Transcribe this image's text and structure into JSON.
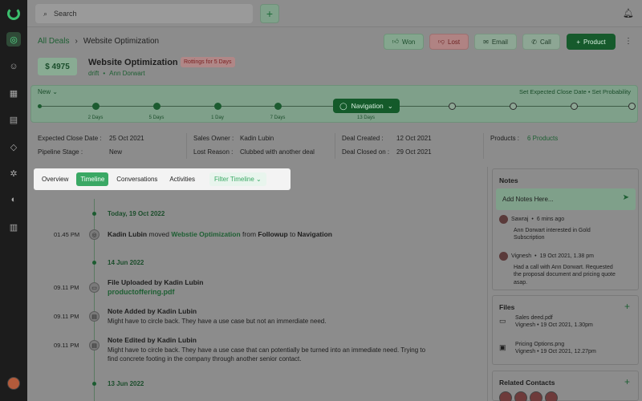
{
  "search": {
    "placeholder": "Search"
  },
  "breadcrumb": {
    "parent": "All Deals",
    "current": "Website Optimization"
  },
  "actions": {
    "won": "Won",
    "lost": "Lost",
    "email": "Email",
    "call": "Call",
    "product": "Product"
  },
  "deal": {
    "amount": "$ 4975",
    "title": "Website Optimization",
    "badge": "Rottings for 5 Days",
    "source": "drift",
    "contact": "Ann Dorwart"
  },
  "pipeline": {
    "stage": "New",
    "set_close": "Set Expected Close Date",
    "set_prob": "Set Probability",
    "current": "Navigation",
    "labels": [
      "2 Days",
      "5 Days",
      "1 Day",
      "7 Days",
      "13 Days"
    ]
  },
  "info": {
    "expected_close_label": "Expected Close Date :",
    "expected_close": "25 Oct 2021",
    "pipeline_stage_label": "Pipeline Stage :",
    "pipeline_stage": "New",
    "sales_owner_label": "Sales Owner :",
    "sales_owner": "Kadin Lubin",
    "lost_reason_label": "Lost Reason :",
    "lost_reason": "Clubbed with another deal",
    "created_label": "Deal Created :",
    "created": "12 Oct 2021",
    "closed_label": "Deal Closed on :",
    "closed": "29 Oct 2021",
    "products_label": "Products :",
    "products": "6 Products"
  },
  "tabs": {
    "overview": "Overview",
    "timeline": "Timeline",
    "conversations": "Conversations",
    "activities": "Activities",
    "filter": "Filter Timeline"
  },
  "timeline": {
    "date1": "Today, 19 Oct 2022",
    "e1_time": "01.45 PM",
    "e1_name": "Kadin Lubin",
    "e1_verb": "moved",
    "e1_deal": "Webstie Optimization",
    "e1_from": "from",
    "e1_stage1": "Followup",
    "e1_to": "to",
    "e1_stage2": "Navigation",
    "date2": "14 Jun 2022",
    "e2_time": "09.11 PM",
    "e2_title": "File Uploaded by Kadin Lubin",
    "e2_file": "productoffering.pdf",
    "e3_time": "09.11 PM",
    "e3_title": "Note Added by Kadin Lubin",
    "e3_sub": "Might have to circle back. They have a use case but not an immerdiate need.",
    "e4_time": "09.11 PM",
    "e4_title": "Note Edited by Kadin Lubin",
    "e4_sub1": "Might have to circle back. They have a use case that can potentially be turned into an immediate need. Trying to",
    "e4_sub2": "find concrete footing in the company through another senior contact.",
    "date3": "13 Jun 2022"
  },
  "notes": {
    "title": "Notes",
    "placeholder": "Add Notes Here...",
    "n1_who": "Sawraj",
    "n1_when": "6 mins ago",
    "n1_text1": "Ann Dorwart interested in Gold",
    "n1_text2": "Subscription",
    "n2_who": "Vignesh",
    "n2_when": "19 Oct 2021, 1.38 pm",
    "n2_text1": "Had a call with Ann Dorwart. Requested",
    "n2_text2": "the proposal document and pricing quote",
    "n2_text3": "asap."
  },
  "files": {
    "title": "Files",
    "f1_name": "Sales deed.pdf",
    "f1_meta": "Vignesh  •  19 Oct 2021, 1.30pm",
    "f2_name": "Pricing Options.png",
    "f2_meta": "Vignesh  •  19 Oct 2021, 12.27pm"
  },
  "contacts": {
    "title": "Related Contacts"
  },
  "colors": {
    "accent": "#3aa864",
    "dark_green": "#165a2c",
    "rail": "#1c1c1c"
  }
}
